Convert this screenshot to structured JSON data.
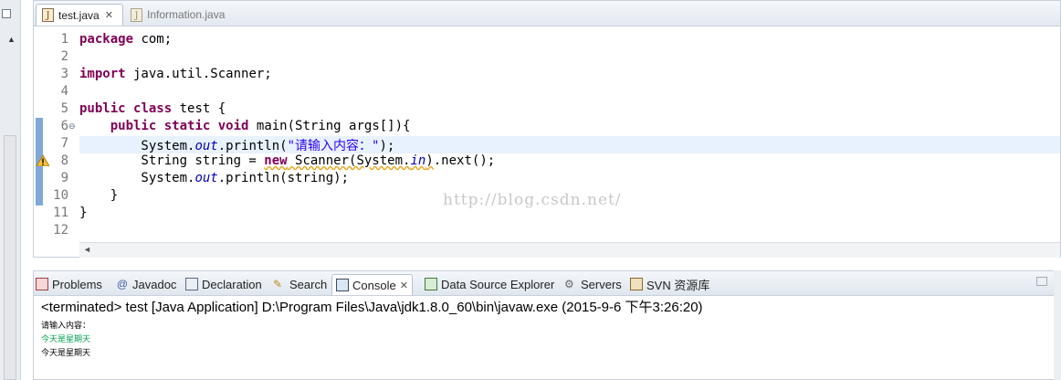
{
  "editor": {
    "tabs": [
      {
        "label": "test.java",
        "active": true
      },
      {
        "label": "Information.java",
        "active": false
      }
    ],
    "lines": [
      {
        "num": "1",
        "text": "package com;"
      },
      {
        "num": "2",
        "text": ""
      },
      {
        "num": "3",
        "text": "import java.util.Scanner;"
      },
      {
        "num": "4",
        "text": ""
      },
      {
        "num": "5",
        "text": "public class test {"
      },
      {
        "num": "6",
        "text": "    public static void main(String args[]){"
      },
      {
        "num": "7",
        "text": "        System.out.println(\"请输入内容：\");"
      },
      {
        "num": "8",
        "text": "        String string = new Scanner(System.in).next();"
      },
      {
        "num": "9",
        "text": "        System.out.println(string);"
      },
      {
        "num": "10",
        "text": "    }"
      },
      {
        "num": "11",
        "text": "}"
      },
      {
        "num": "12",
        "text": ""
      }
    ],
    "watermark": "http://blog.csdn.net/"
  },
  "panel": {
    "tabs": [
      {
        "label": "Problems",
        "icon": "problems-icon"
      },
      {
        "label": "Javadoc",
        "icon": "javadoc-icon"
      },
      {
        "label": "Declaration",
        "icon": "declaration-icon"
      },
      {
        "label": "Search",
        "icon": "search-icon"
      },
      {
        "label": "Console",
        "icon": "console-icon",
        "active": true
      },
      {
        "label": "Data Source Explorer",
        "icon": "data-source-icon"
      },
      {
        "label": "Servers",
        "icon": "servers-icon"
      },
      {
        "label": "SVN 资源库",
        "icon": "svn-icon"
      }
    ],
    "console_header": "<terminated> test [Java Application] D:\\Program Files\\Java\\jdk1.8.0_60\\bin\\javaw.exe (2015-9-6 下午3:26:20)",
    "output": [
      {
        "text": "请输入内容：",
        "color": "#000000"
      },
      {
        "text": "今天是星期天",
        "color": "#00a050"
      },
      {
        "text": "今天是星期天",
        "color": "#000000"
      }
    ]
  },
  "colors": {
    "keyword": "#7f0055",
    "field": "#0000c0",
    "string": "#2a00ff",
    "current_line": "#e8f2fe",
    "input_text": "#00a050"
  }
}
